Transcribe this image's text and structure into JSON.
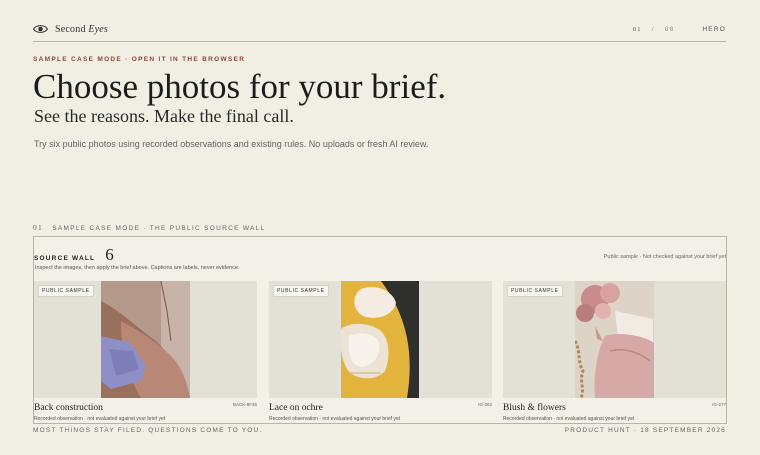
{
  "brand": {
    "name_part1": "Second",
    "name_part2": "Eyes"
  },
  "nav": {
    "current": "01",
    "separator": "/",
    "total": "08",
    "section": "HERO"
  },
  "hero": {
    "kicker": "SAMPLE CASE MODE · OPEN IT IN THE BROWSER",
    "title": "Choose photos for your brief.",
    "subtitle": "See the reasons. Make the final call.",
    "lead": "Try six public photos using recorded observations and existing rules. No uploads or fresh AI review."
  },
  "section": {
    "number": "01",
    "label": "SAMPLE CASE MODE · THE PUBLIC SOURCE WALL"
  },
  "wall": {
    "title": "SOURCE WALL",
    "count": "6",
    "note": "Public sample · Not checked against your brief yet",
    "subtitle": "Inspect the images, then apply the brief above. Captions are labels, never evidence.",
    "cards": [
      {
        "badge": "PUBLIC SAMPLE",
        "name": "Back construction",
        "code": "BACK-8F35",
        "observation": "Recorded observation · not evaluated against your brief yet"
      },
      {
        "badge": "PUBLIC SAMPLE",
        "name": "Lace on ochre",
        "code": "IG-282",
        "observation": "Recorded observation · not evaluated against your brief yet"
      },
      {
        "badge": "PUBLIC SAMPLE",
        "name": "Blush & flowers",
        "code": "IG-277",
        "observation": "Recorded observation · not evaluated against your brief yet"
      }
    ]
  },
  "footer": {
    "left": "MOST THINGS STAY FILED. QUESTIONS COME TO YOU.",
    "right": "PRODUCT HUNT · 18 SEPTEMBER 2026"
  },
  "colors": {
    "background": "#f1eee4",
    "kicker": "#8a4a3a",
    "border": "#b9b4a6",
    "ochre": "#e0b23a"
  }
}
